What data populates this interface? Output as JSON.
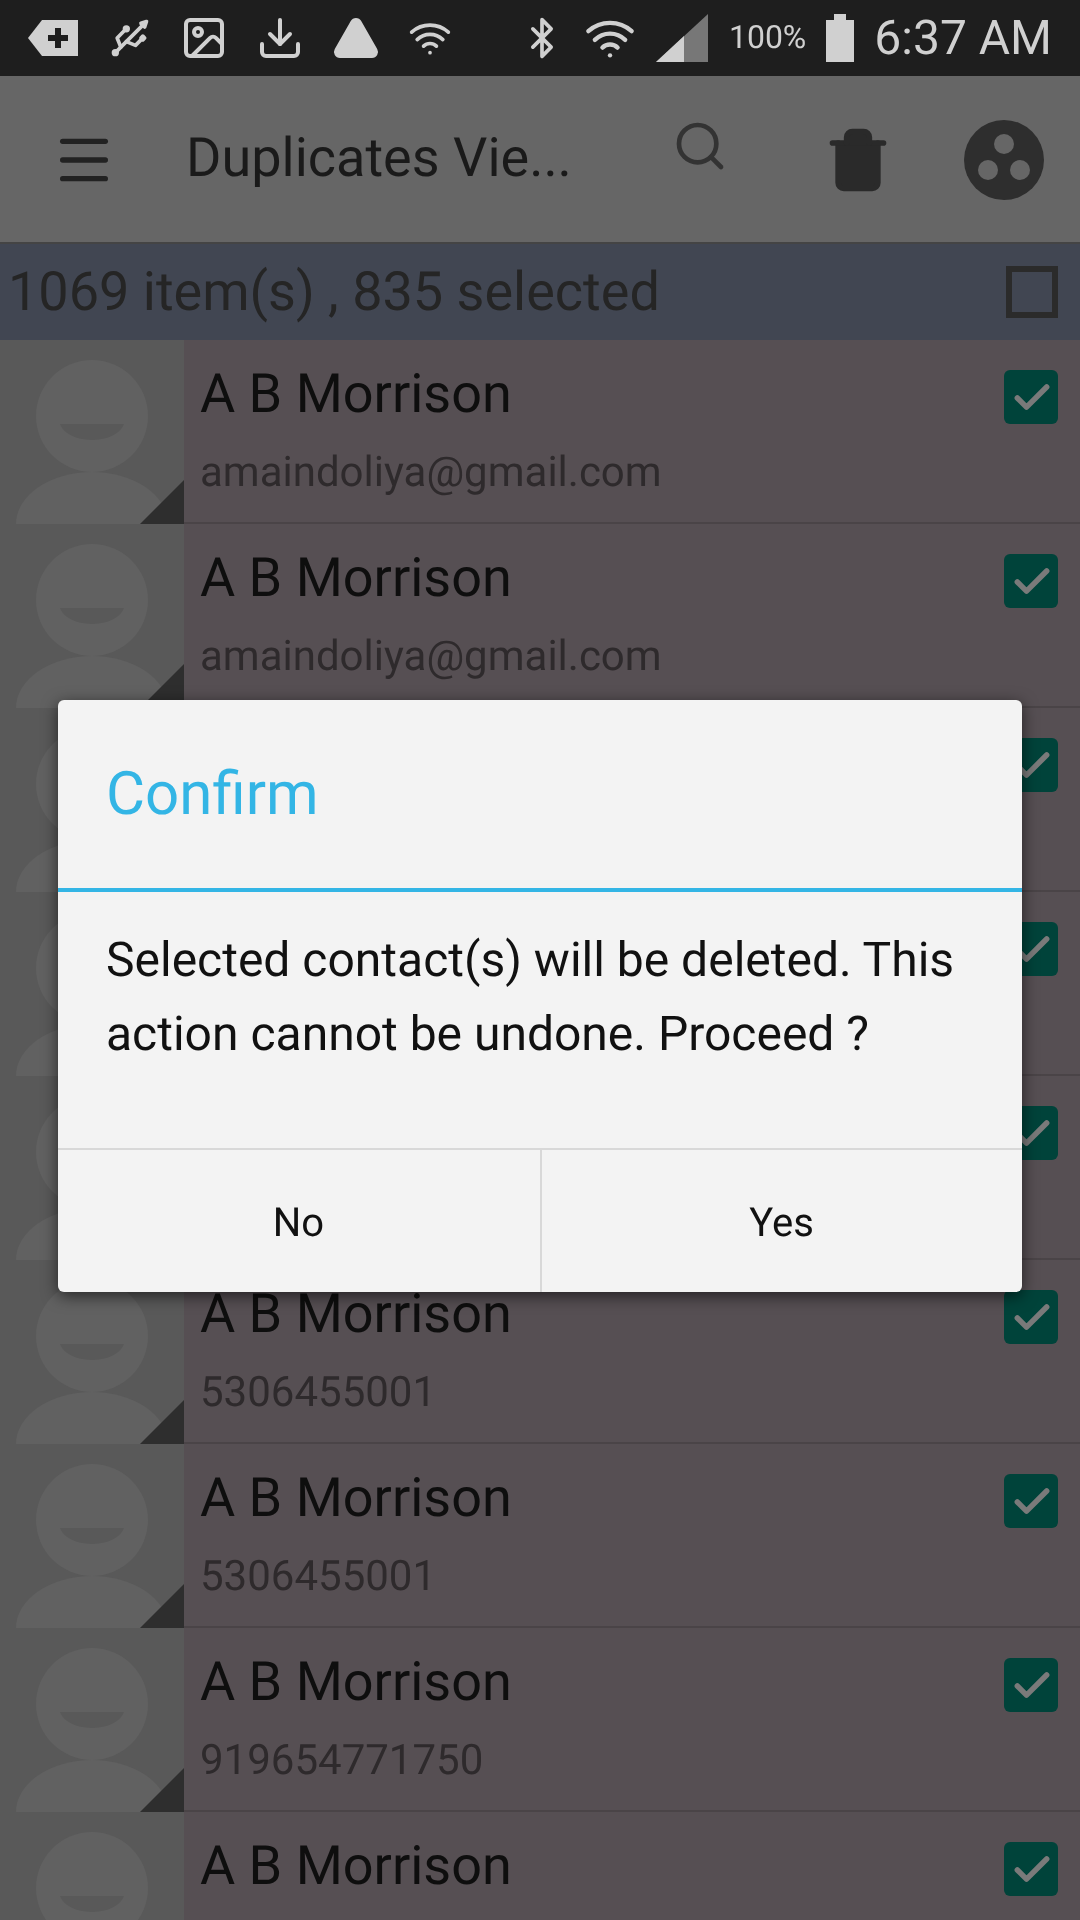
{
  "status_bar": {
    "battery": "100%",
    "time": "6:37 AM"
  },
  "toolbar": {
    "title": "Duplicates Vie..."
  },
  "summary": {
    "text": "1069 item(s) , 835 selected",
    "all_checked": false
  },
  "rows": [
    {
      "name": "A B Morrison",
      "detail": "amaindoliya@gmail.com",
      "checked": true
    },
    {
      "name": "A B Morrison",
      "detail": "amaindoliya@gmail.com",
      "checked": true
    },
    {
      "checked": true
    },
    {
      "checked": true
    },
    {
      "checked": true
    },
    {
      "name": "A B Morrison",
      "detail": "5306455001",
      "checked": true
    },
    {
      "name": "A B Morrison",
      "detail": "5306455001",
      "checked": true
    },
    {
      "name": "A B Morrison",
      "detail": "919654771750",
      "checked": true
    },
    {
      "name": "A B Morrison",
      "checked": true
    }
  ],
  "dialog": {
    "title": "Confirm",
    "message": "Selected contact(s) will be deleted. This action cannot be undone. Proceed ?",
    "buttons": [
      "No",
      "Yes"
    ]
  }
}
